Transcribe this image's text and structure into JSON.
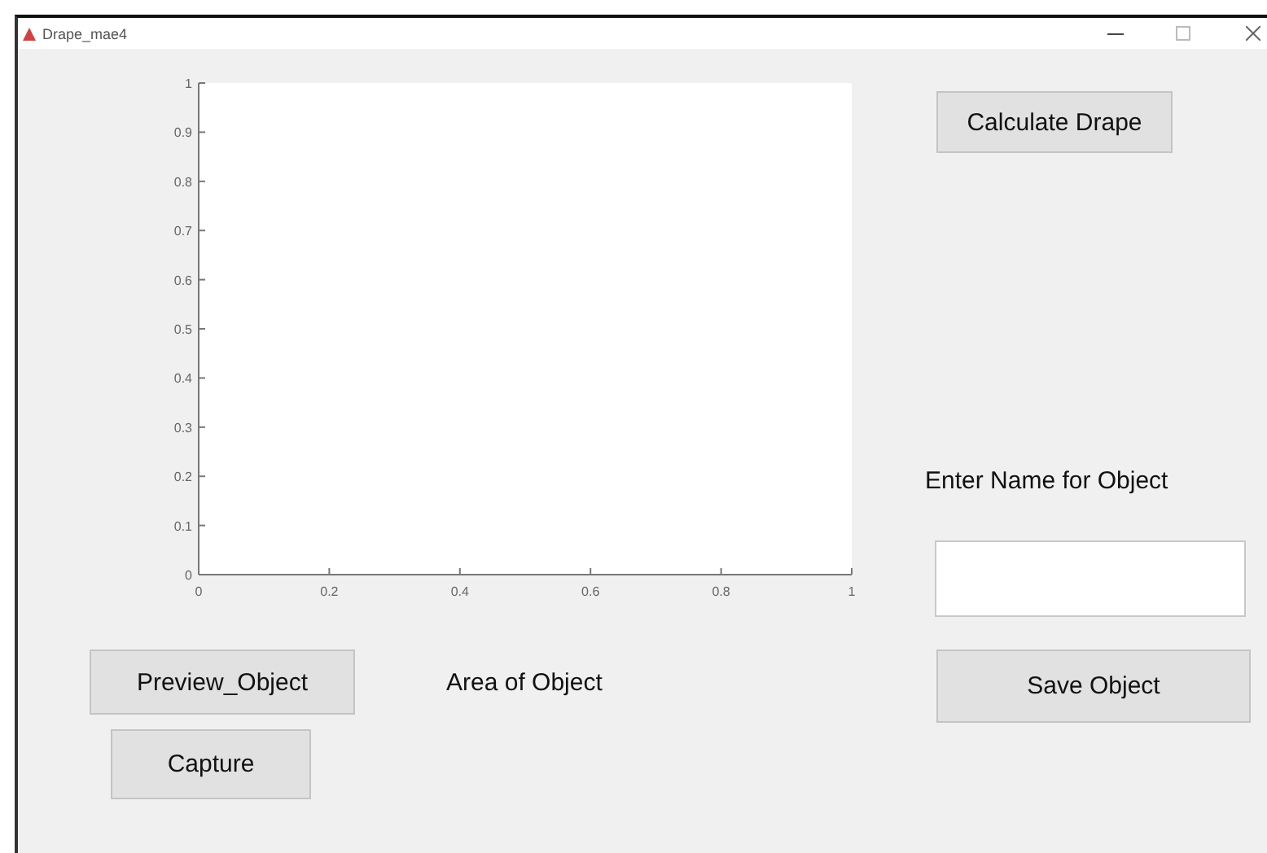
{
  "window": {
    "title": "Drape_mae4"
  },
  "chart": {
    "chart_data": {
      "type": "line",
      "xlim": [
        0,
        1
      ],
      "ylim": [
        0,
        1
      ],
      "xticks": [
        {
          "value": 0,
          "label": "0"
        },
        {
          "value": 0.2,
          "label": "0.2"
        },
        {
          "value": 0.4,
          "label": "0.4"
        },
        {
          "value": 0.6,
          "label": "0.6"
        },
        {
          "value": 0.8,
          "label": "0.8"
        },
        {
          "value": 1,
          "label": "1"
        }
      ],
      "yticks": [
        {
          "value": 0,
          "label": "0"
        },
        {
          "value": 0.1,
          "label": "0.1"
        },
        {
          "value": 0.2,
          "label": "0.2"
        },
        {
          "value": 0.3,
          "label": "0.3"
        },
        {
          "value": 0.4,
          "label": "0.4"
        },
        {
          "value": 0.5,
          "label": "0.5"
        },
        {
          "value": 0.6,
          "label": "0.6"
        },
        {
          "value": 0.7,
          "label": "0.7"
        },
        {
          "value": 0.8,
          "label": "0.8"
        },
        {
          "value": 0.9,
          "label": "0.9"
        },
        {
          "value": 1,
          "label": "1"
        }
      ]
    }
  },
  "preview_button": "Preview_Object",
  "area_label": "Area of Object",
  "capture_button": "Capture",
  "calculate_button": "Calculate Drape",
  "name_label": "Enter Name for Object",
  "save_button": "Save Object"
}
